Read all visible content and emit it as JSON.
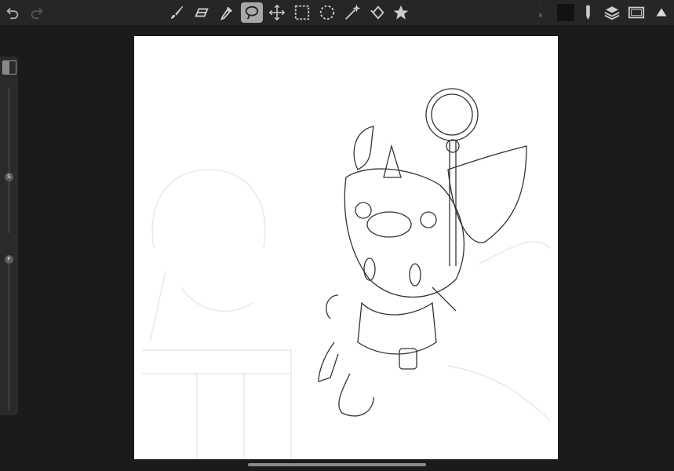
{
  "toolbar": {
    "undo": "undo-icon",
    "redo": "redo-icon",
    "tools": [
      "brush",
      "eraser",
      "eyedropper",
      "lasso",
      "move",
      "rect-select",
      "ellipse-select",
      "magic-wand",
      "transform",
      "star"
    ],
    "active_tool": "lasso",
    "brush_size": "8",
    "current_color": "#121212"
  },
  "side_panel": {
    "size_slider_label": "S",
    "flow_slider_label": "F"
  }
}
